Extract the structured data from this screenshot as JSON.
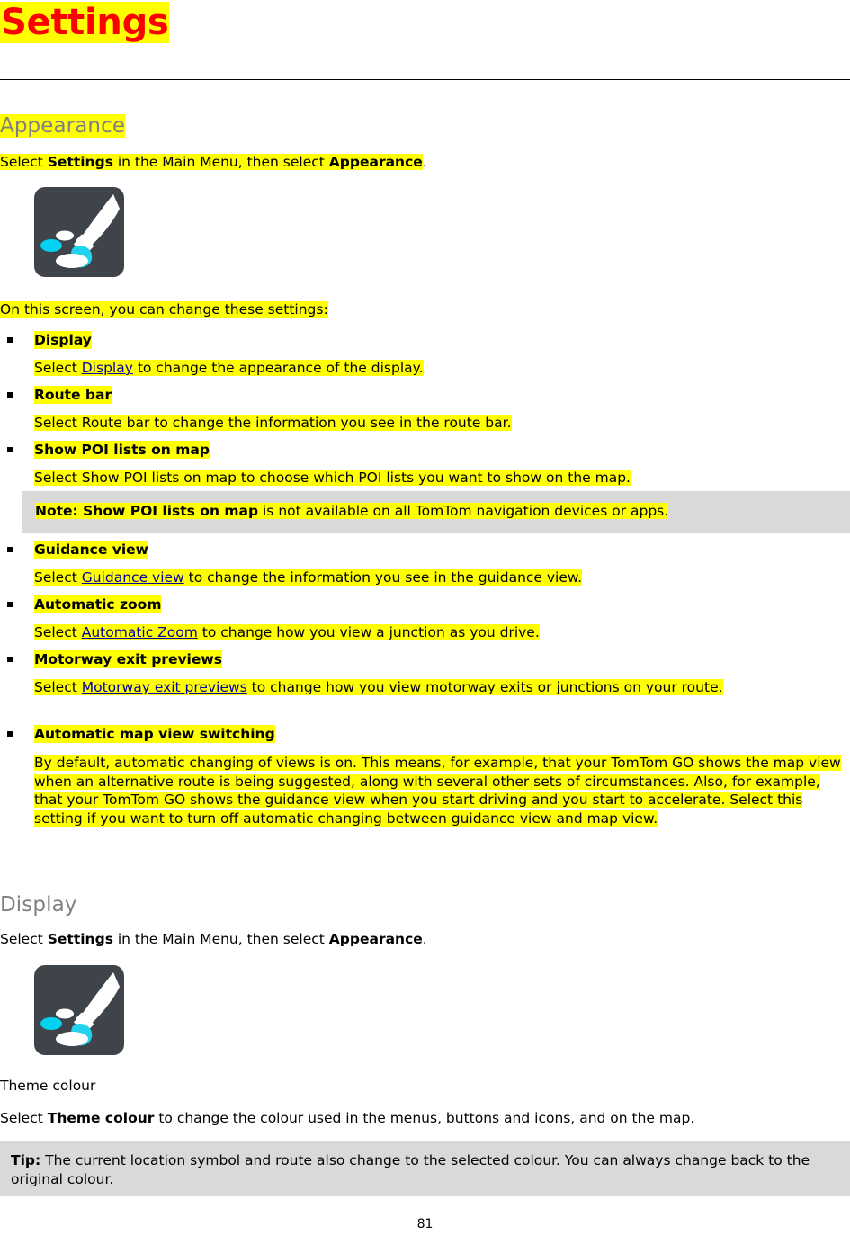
{
  "document": {
    "chapter_title": "Settings",
    "page_number": "81"
  },
  "sections": {
    "appearance": {
      "heading": "Appearance",
      "intro_select": "Select ",
      "intro_bold1": "Settings",
      "intro_mid": " in the Main Menu, then select ",
      "intro_bold2": "Appearance",
      "intro_end": ".",
      "icon_name": "appearance-paintbrush-icon",
      "lead_in": "On this screen, you can change these settings:",
      "items": [
        {
          "label": "Display",
          "desc_pre": "Select ",
          "desc_link": "Display",
          "desc_post": " to change the appearance of the display."
        },
        {
          "label": "Route bar",
          "desc_pre": "Select Route bar to change the information you see in the route bar.",
          "desc_link": "",
          "desc_post": ""
        },
        {
          "label": "Show POI lists on map",
          "desc_pre": "Select Show POI lists on map to choose which POI lists you want to show on the map.",
          "desc_link": "",
          "desc_post": ""
        },
        {
          "label": "Guidance view",
          "desc_pre": "Select ",
          "desc_link": "Guidance view",
          "desc_post": " to change the information you see in the guidance view."
        },
        {
          "label": "Automatic zoom",
          "desc_pre": "Select ",
          "desc_link": "Automatic Zoom",
          "desc_post": " to change how you view a junction as you drive."
        },
        {
          "label": "Motorway exit previews",
          "desc_pre": "Select ",
          "desc_link": "Motorway exit previews",
          "desc_post": " to change how you view motorway exits or junctions on your route."
        },
        {
          "label": "Automatic map view switching",
          "desc_pre": "By default, automatic changing of views is on. This means, for example, that your TomTom GO shows the map view when an alternative route is being suggested, along with several other sets of circumstances. Also, for example, that your TomTom GO shows the guidance view when you start driving and you start to accelerate. Select this setting if you want to turn off automatic changing between guidance view and map view.",
          "desc_link": "",
          "desc_post": ""
        }
      ],
      "note": {
        "label": "Note:",
        "bold_term": " Show POI lists on map",
        "rest": " is not available on all TomTom navigation devices or apps."
      }
    },
    "display": {
      "heading": "Display",
      "intro_select": "Select ",
      "intro_bold1": "Settings",
      "intro_mid": " in the Main Menu, then select ",
      "intro_bold2": "Appearance",
      "intro_end": ".",
      "icon_name": "display-paintbrush-icon",
      "subheading": "Theme colour",
      "body_pre": "Select ",
      "body_bold": "Theme colour",
      "body_post": " to change the colour used in the menus, buttons and icons, and on the map.",
      "tip": {
        "label": "Tip:",
        "rest": " The current location symbol and route also change to the selected colour. You can always change back to the original colour."
      }
    }
  },
  "colors": {
    "highlight": "#ffff00",
    "title": "#ff0000",
    "heading": "#808080",
    "link": "#0000a0",
    "note_bg": "#d9d9d9",
    "icon_bg": "#3f434a",
    "icon_accent": "#22d3ee"
  }
}
